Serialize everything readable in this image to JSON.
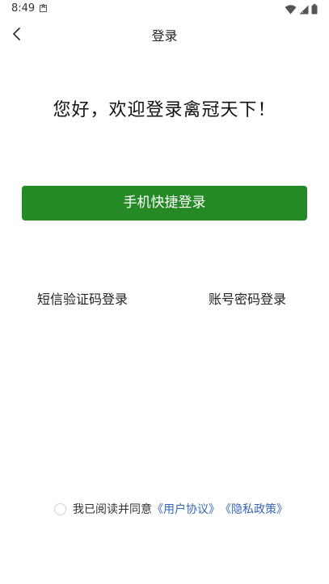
{
  "status_bar": {
    "time": "8:49",
    "icons": [
      "notification-a-icon",
      "wifi-icon",
      "signal-icon",
      "battery-icon"
    ]
  },
  "nav": {
    "title": "登录",
    "back_icon": "chevron-left-icon"
  },
  "welcome": {
    "title": "您好，欢迎登录禽冠天下！"
  },
  "actions": {
    "quick_login_label": "手机快捷登录",
    "sms_login_label": "短信验证码登录",
    "password_login_label": "账号密码登录"
  },
  "agreement": {
    "prefix": "我已阅读并同意",
    "user_agreement": "《用户协议》",
    "privacy_policy": "《隐私政策》",
    "checked": false
  },
  "colors": {
    "primary": "#258a26",
    "link": "#3566b8"
  }
}
